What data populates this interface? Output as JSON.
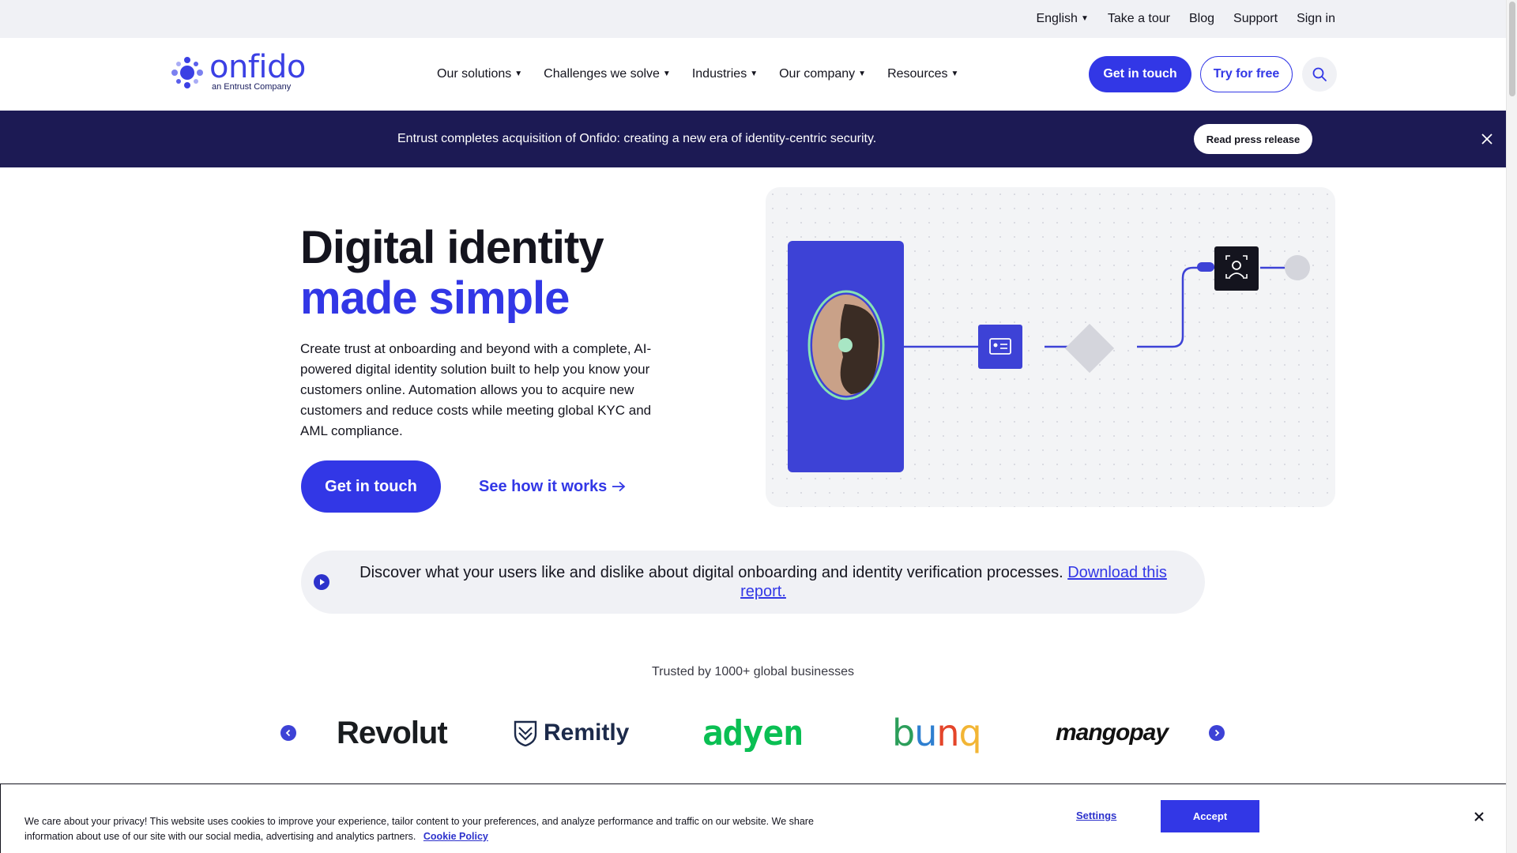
{
  "utility_nav": {
    "language": "English",
    "links": [
      "Take a tour",
      "Blog",
      "Support",
      "Sign in"
    ]
  },
  "brand": {
    "name": "onfido",
    "tagline": "an Entrust Company",
    "accent_color": "#3237e6",
    "dark_color": "#1c1a54"
  },
  "main_nav": {
    "menu": [
      "Our solutions",
      "Challenges we solve",
      "Industries",
      "Our company",
      "Resources"
    ],
    "get_in_touch": "Get in touch",
    "try_free": "Try for free",
    "search_icon": "search-icon"
  },
  "announcement": {
    "text": "Entrust completes acquisition of Onfido: creating a new era of identity-centric security.",
    "button": "Read press release",
    "close_icon": "close-icon"
  },
  "hero": {
    "title_line1": "Digital identity",
    "title_line2": "made simple",
    "description": "Create trust at onboarding and beyond with a complete, AI-powered digital identity solution built to help you know your customers online.  Automation allows you to acquire new customers and reduce costs while meeting global KYC and AML compliance.",
    "cta_primary": "Get in touch",
    "cta_secondary": "See how it works",
    "cta_secondary_icon": "arrow-right-icon"
  },
  "report": {
    "text": "Discover what your users like and dislike about digital onboarding and identity verification processes.",
    "link": "Download this report.",
    "icon": "play-icon"
  },
  "trusted": {
    "heading": "Trusted by 1000+ global businesses",
    "logos": [
      "Revolut",
      "Remitly",
      "adyen",
      "bunq",
      "mangopay"
    ]
  },
  "cookie_banner": {
    "text": "We care about your privacy! This website uses cookies to improve your experience, tailor content to your preferences, and analyze performance and traffic on our website. We share information about use of our site with our social media, advertising and analytics partners.",
    "policy_link": "Cookie Policy",
    "settings": "Settings",
    "accept": "Accept"
  }
}
